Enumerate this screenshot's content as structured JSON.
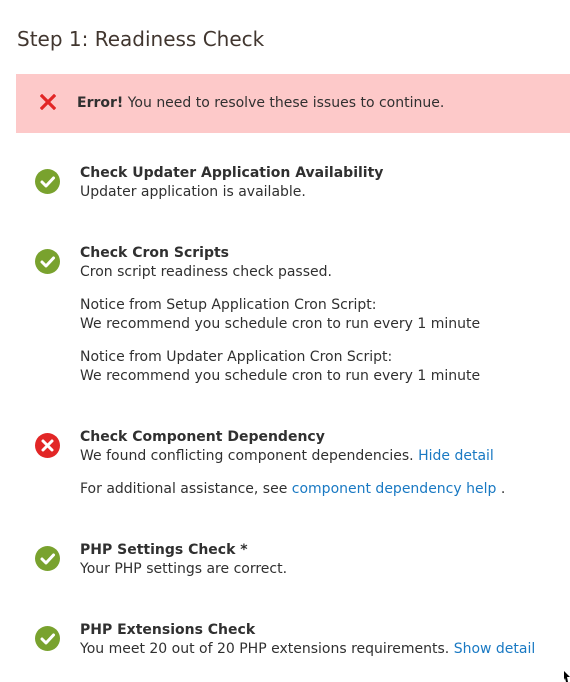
{
  "page": {
    "title": "Step 1: Readiness Check"
  },
  "error": {
    "label": "Error!",
    "message": " You need to resolve these issues to continue."
  },
  "checks": [
    {
      "status": "success",
      "title": "Check Updater Application Availability",
      "message": "Updater application is available."
    },
    {
      "status": "success",
      "title": "Check Cron Scripts",
      "message": "Cron script readiness check passed.",
      "notices": [
        {
          "line1": "Notice from Setup Application Cron Script:",
          "line2": "We recommend you schedule cron to run every 1 minute"
        },
        {
          "line1": "Notice from Updater Application Cron Script:",
          "line2": "We recommend you schedule cron to run every 1 minute"
        }
      ]
    },
    {
      "status": "error",
      "title": "Check Component Dependency",
      "message": "We found conflicting component dependencies. ",
      "detail_link": "Hide detail",
      "help_prefix": "For additional assistance, see ",
      "help_link": "component dependency help",
      "help_suffix": " ."
    },
    {
      "status": "success",
      "title": "PHP Settings Check *",
      "message": "Your PHP settings are correct."
    },
    {
      "status": "success",
      "title": "PHP Extensions Check",
      "message": "You meet 20 out of 20 PHP extensions requirements. ",
      "detail_link": "Show detail"
    }
  ],
  "colors": {
    "success": "#79a22e",
    "error": "#e22626",
    "error_banner_bg": "#fdc9c9",
    "link": "#1979c3"
  }
}
